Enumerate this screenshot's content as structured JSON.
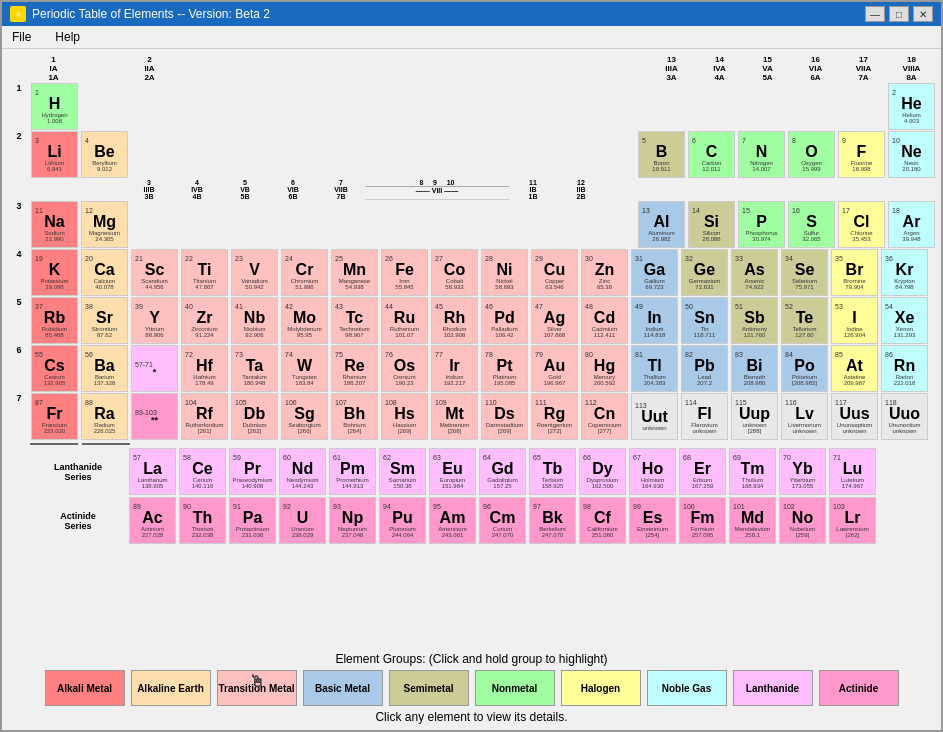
{
  "window": {
    "title": "Periodic Table of Elements  -- Version: Beta 2",
    "menu": [
      "File",
      "Help"
    ]
  },
  "groups": {
    "title": "Element Groups:  (Click and hold group to highlight)",
    "items": [
      {
        "name": "alkali",
        "label": "Alkali Metal",
        "color": "#ff8080"
      },
      {
        "name": "alkaline",
        "label": "Alkaline Earth",
        "color": "#ffdead"
      },
      {
        "name": "transition",
        "label": "Transition Metal",
        "color": "#ffc0c0"
      },
      {
        "name": "basic",
        "label": "Basic Metal",
        "color": "#a9c9e8"
      },
      {
        "name": "semimetal",
        "label": "Semimetal",
        "color": "#cccc99"
      },
      {
        "name": "nonmetal",
        "label": "Nonmetal",
        "color": "#a0ffa0"
      },
      {
        "name": "halogen",
        "label": "Halogen",
        "color": "#ffff99"
      },
      {
        "name": "noble",
        "label": "Noble Gas",
        "color": "#c0ffff"
      },
      {
        "name": "lanthanide",
        "label": "Lanthanide",
        "color": "#ffbfff"
      },
      {
        "name": "actinide",
        "label": "Actinide",
        "color": "#ff99cc"
      }
    ]
  },
  "bottom_text": "Click any element to view its details.",
  "elements": [
    {
      "num": 1,
      "sym": "H",
      "name": "Hydrogen",
      "mass": "1.008",
      "group": "nonmetal",
      "row": 1,
      "col": 1
    },
    {
      "num": 2,
      "sym": "He",
      "name": "Helium",
      "mass": "4.003",
      "group": "noble",
      "row": 1,
      "col": 18
    },
    {
      "num": 3,
      "sym": "Li",
      "name": "Lithium",
      "mass": "6.941",
      "group": "alkali",
      "row": 2,
      "col": 1
    },
    {
      "num": 4,
      "sym": "Be",
      "name": "Beryllium",
      "mass": "9.012",
      "group": "alkaline",
      "row": 2,
      "col": 2
    },
    {
      "num": 5,
      "sym": "B",
      "name": "Boron",
      "mass": "10.811",
      "group": "semimetal",
      "row": 2,
      "col": 13
    },
    {
      "num": 6,
      "sym": "C",
      "name": "Carbon",
      "mass": "12.011",
      "group": "nonmetal",
      "row": 2,
      "col": 14
    },
    {
      "num": 7,
      "sym": "N",
      "name": "Nitrogen",
      "mass": "14.007",
      "group": "nonmetal",
      "row": 2,
      "col": 15
    },
    {
      "num": 8,
      "sym": "O",
      "name": "Oxygen",
      "mass": "15.999",
      "group": "nonmetal",
      "row": 2,
      "col": 16
    },
    {
      "num": 9,
      "sym": "F",
      "name": "Fluorine",
      "mass": "18.998",
      "group": "halogen",
      "row": 2,
      "col": 17
    },
    {
      "num": 10,
      "sym": "Ne",
      "name": "Neon",
      "mass": "20.180",
      "group": "noble",
      "row": 2,
      "col": 18
    },
    {
      "num": 11,
      "sym": "Na",
      "name": "Sodium",
      "mass": "22.990",
      "group": "alkali",
      "row": 3,
      "col": 1
    },
    {
      "num": 12,
      "sym": "Mg",
      "name": "Magnesium",
      "mass": "24.305",
      "group": "alkaline",
      "row": 3,
      "col": 2
    },
    {
      "num": 13,
      "sym": "Al",
      "name": "Aluminum",
      "mass": "26.982",
      "group": "basic-metal",
      "row": 3,
      "col": 13
    },
    {
      "num": 14,
      "sym": "Si",
      "name": "Silicon",
      "mass": "28.086",
      "group": "semimetal",
      "row": 3,
      "col": 14
    },
    {
      "num": 15,
      "sym": "P",
      "name": "Phosphorus",
      "mass": "30.974",
      "group": "nonmetal",
      "row": 3,
      "col": 15
    },
    {
      "num": 16,
      "sym": "S",
      "name": "Sulfur",
      "mass": "32.065",
      "group": "nonmetal",
      "row": 3,
      "col": 16
    },
    {
      "num": 17,
      "sym": "Cl",
      "name": "Chlorine",
      "mass": "35.453",
      "group": "halogen",
      "row": 3,
      "col": 17
    },
    {
      "num": 18,
      "sym": "Ar",
      "name": "Argon",
      "mass": "39.948",
      "group": "noble",
      "row": 3,
      "col": 18
    }
  ]
}
